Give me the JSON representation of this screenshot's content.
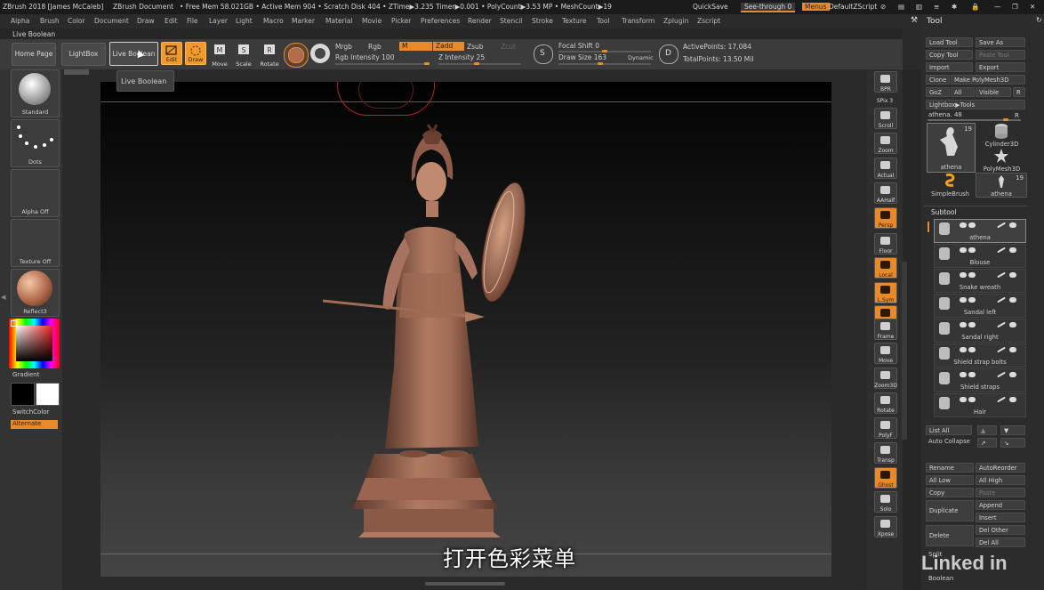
{
  "titlebar": {
    "app": "ZBrush 2018 [James McCaleb]",
    "doc": "ZBrush Document",
    "stats": "• Free Mem 58.021GB • Active Mem 904 • Scratch Disk 404 • ZTime▶3.235 Timer▶0.001 • PolyCount▶3.53 MP • MeshCount▶19",
    "quicksave": "QuickSave",
    "see_through": "See-through  0",
    "menus": "Menus",
    "script": "DefaultZScript"
  },
  "menubar": [
    "Alpha",
    "Brush",
    "Color",
    "Document",
    "Draw",
    "Edit",
    "File",
    "Layer",
    "Light",
    "Macro",
    "Marker",
    "Material",
    "Movie",
    "Picker",
    "Preferences",
    "Render",
    "Stencil",
    "Stroke",
    "Texture",
    "Tool",
    "Transform",
    "Zplugin",
    "Zscript"
  ],
  "subbar_label": "Live Boolean",
  "shelf": {
    "home_page": "Home Page",
    "lightbox": "LightBox",
    "live_boolean": "Live Boolean",
    "edit": "Edit",
    "draw": "Draw",
    "move": "Move",
    "scale": "Scale",
    "rotate": "Rotate",
    "mrgb": "Mrgb",
    "rgb": "Rgb",
    "m": "M",
    "zadd": "Zadd",
    "zsub": "Zsub",
    "zcut": "Zcut",
    "rgb_intensity": "Rgb Intensity 100",
    "z_intensity": "Z Intensity 25",
    "focal_shift": "Focal Shift 0",
    "draw_size": "Draw Size 163",
    "dynamic": "Dynamic",
    "active_points": "ActivePoints: 17,084",
    "total_points": "TotalPoints: 13.50 Mil"
  },
  "tooltip": "Live Boolean",
  "left": {
    "standard": "Standard",
    "dots": "Dots",
    "alpha_off": "Alpha Off",
    "texture_off": "Texture Off",
    "material": "Reflect3",
    "gradient": "Gradient",
    "switchcolor": "SwitchColor",
    "alternate": "Alternate"
  },
  "right_icons": [
    "BPR",
    "SPix 3",
    "Scroll",
    "Zoom",
    "Actual",
    "AAHalf",
    "Persp",
    "Floor",
    "Local",
    "L.Sym",
    "Qxyz",
    "Frame",
    "Move",
    "Zoom3D",
    "Rotate",
    "PolyF",
    "Transp",
    "Ghost",
    "Solo",
    "Xpose"
  ],
  "tool": {
    "title": "Tool",
    "load_tool": "Load Tool",
    "save_as": "Save As",
    "copy_tool": "Copy Tool",
    "paste_tool": "Paste Tool",
    "import": "Import",
    "export": "Export",
    "clone": "Clone",
    "make_polymesh": "Make PolyMesh3D",
    "goz": "GoZ",
    "all": "All",
    "visible": "Visible",
    "r": "R",
    "lightbox_tools": "Lightbox▶Tools",
    "current_tool": "athena. 48",
    "thumbs": [
      {
        "label": "athena",
        "count": "19"
      },
      {
        "label": "Cylinder3D",
        "count": ""
      },
      {
        "label": "PolyMesh3D",
        "count": ""
      },
      {
        "label": "SimpleBrush",
        "count": ""
      },
      {
        "label": "athena",
        "count": "19"
      }
    ]
  },
  "subtool": {
    "title": "Subtool",
    "items": [
      "athena",
      "Blouse",
      "Snake wreath",
      "Sandal left",
      "Sandal right",
      "Shield strap bolts",
      "Shield straps",
      "Hair"
    ],
    "list_all": "List All",
    "auto_collapse": "Auto Collapse",
    "rename": "Rename",
    "auto_reorder": "AutoReorder",
    "all_low": "All Low",
    "all_high": "All High",
    "copy": "Copy",
    "paste": "Paste",
    "duplicate": "Duplicate",
    "append": "Append",
    "insert": "Insert",
    "delete": "Delete",
    "del_other": "Del Other",
    "del_all": "Del All",
    "split": "Split",
    "boolean": "Boolean"
  },
  "subtitle": "打开色彩菜单",
  "watermark": "Linked in",
  "colors": {
    "accent": "#f19a2b",
    "statue": "#a4705a",
    "canvas_bg": "#1e1e1e"
  }
}
